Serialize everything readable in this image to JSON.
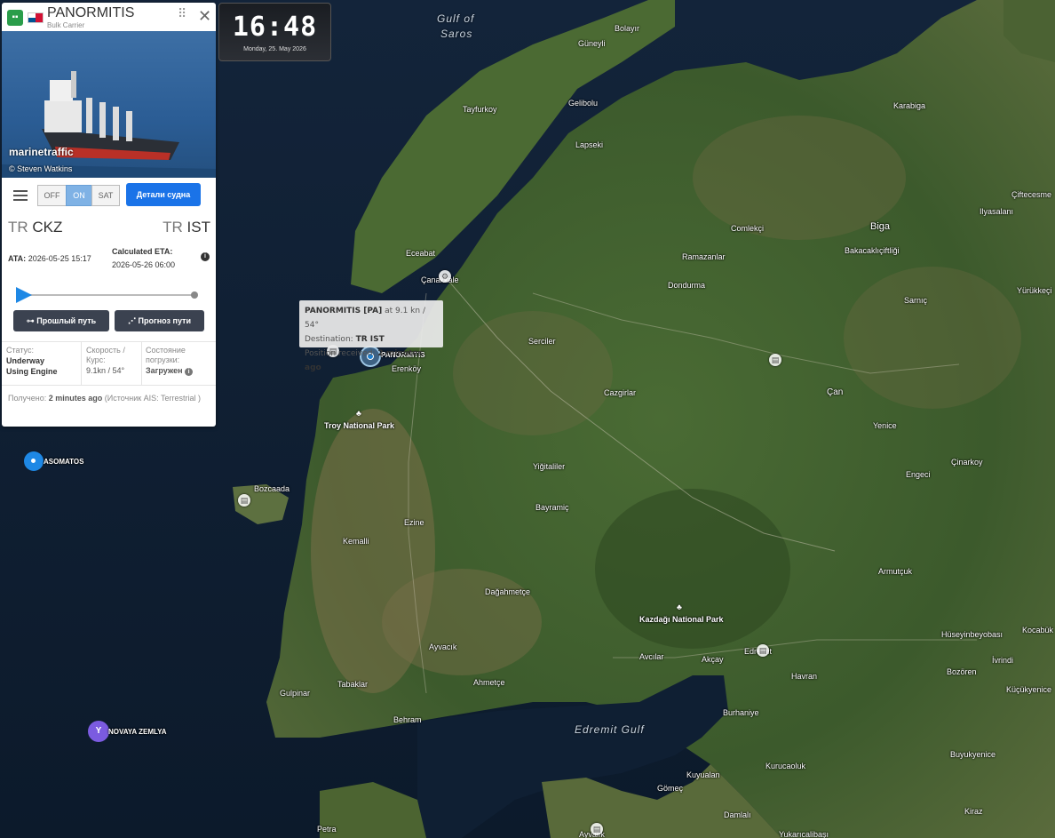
{
  "clock": {
    "time": "16:48",
    "date": "Monday, 25. May 2026"
  },
  "vessel": {
    "name": "PANORMITIS",
    "type": "Bulk Carrier",
    "photo_brand": "marinetraffic",
    "photo_credit": "© Steven Watkins",
    "toggle": {
      "off": "OFF",
      "on": "ON",
      "sat": "SAT"
    },
    "details_button": "Детали судна",
    "from_country": "TR",
    "from_port": "CKZ",
    "to_country": "TR",
    "to_port": "IST",
    "ata_label": "ATA:",
    "ata_value": "2026-05-25 15:17",
    "eta_label": "Calculated ETA:",
    "eta_value": "2026-05-26 06:00",
    "info_icon": "i",
    "past_track_button": "Прошлый путь",
    "forecast_button": "Прогноз пути",
    "status_label": "Статус:",
    "status_value": "Underway Using Engine",
    "speed_label": "Скорость / Курс:",
    "speed_value": "9.1kn / 54°",
    "load_label": "Состояние погрузки:",
    "load_value": "Загружен",
    "received_label": "Получено:",
    "received_value": "2 minutes ago",
    "received_source": "(Источник AIS: Terrestrial )"
  },
  "tooltip": {
    "title": "PANORMITIS [PA]",
    "speed": "at 9.1 kn / 54°",
    "dest_label": "Destination:",
    "dest_value": "TR IST",
    "pos_label": "Position received:",
    "pos_value": "2 minutes ago"
  },
  "markers": [
    {
      "name": "PANORMITIS"
    },
    {
      "name": "ASOMATOS"
    },
    {
      "name": "NOVAYA ZEMLYA"
    }
  ],
  "water_labels": [
    "Gulf of",
    "Saros",
    "Edremit Gulf"
  ],
  "places": [
    "Bolayır",
    "Güneyli",
    "Tayfurkoy",
    "Gelibolu",
    "Lapseki",
    "Karabiga",
    "Çiftecesme",
    "Ilyasalanı",
    "Biga",
    "Comlekçi",
    "Bakacaklıçiftliği",
    "Ramazanlar",
    "Yürükkeçi",
    "Eceabat",
    "Çanakkale",
    "Dondurma",
    "Sarnıç",
    "Serciler",
    "Erenköy",
    "Çan",
    "Cazgirlar",
    "Troy National Park",
    "Yenice",
    "Çinarkoy",
    "Bozcaada",
    "Yiğitaliler",
    "Engeci",
    "Bayramiç",
    "Ezine",
    "Kemalli",
    "Armutçuk",
    "Dağahmetçe",
    "Kazdağı National Park",
    "Hüseyinbeyobası",
    "Kocabük",
    "Ayvacık",
    "Avcılar",
    "Akçay",
    "Edremit",
    "İvrindi",
    "Havran",
    "Bozören",
    "Gulpinar",
    "Tabaklar",
    "Ahmetçe",
    "Küçükyenice",
    "Burhaniye",
    "Behram",
    "Kurucaoluk",
    "Kuyualan",
    "Buyukyenice",
    "Gömeç",
    "Kiraz",
    "Damlalı",
    "Petra",
    "Ayvalık",
    "Yukarıcalibaşı"
  ]
}
